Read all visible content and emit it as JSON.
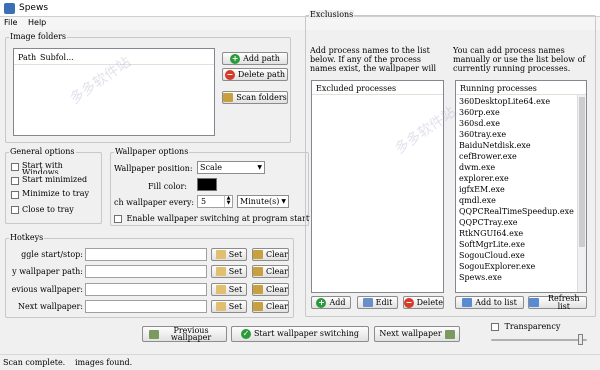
{
  "window": {
    "title": "Spews"
  },
  "menu": [
    "File",
    "Help"
  ],
  "image_folders": {
    "legend": "Image folders",
    "columns": [
      "Path",
      "Subfol..."
    ],
    "add_label": "Add path",
    "delete_label": "Delete path",
    "scan_label": "Scan folders"
  },
  "general": {
    "legend": "General options",
    "options": [
      {
        "label": "Start with Windows",
        "checked": false
      },
      {
        "label": "Start minimized",
        "checked": false
      },
      {
        "label": "Minimize to tray",
        "checked": false
      },
      {
        "label": "Close to tray",
        "checked": false
      }
    ]
  },
  "wallpaper": {
    "legend": "Wallpaper options",
    "position_label": "Wallpaper position:",
    "position_value": "Scale",
    "fill_label": "Fill color:",
    "fill_color": "#000000",
    "every_label": "ch wallpaper every:",
    "every_value": "5",
    "unit_value": "Minute(s)",
    "enable_label": "Enable wallpaper switching at program startup"
  },
  "hotkeys": {
    "legend": "Hotkeys",
    "set_label": "Set",
    "clear_label": "Clear",
    "rows": [
      {
        "label": "ggle start/stop:"
      },
      {
        "label": "y wallpaper path:"
      },
      {
        "label": "evious wallpaper:"
      },
      {
        "label": "Next wallpaper:"
      }
    ]
  },
  "exclusions": {
    "legend": "Exclusions",
    "desc_left": "Add process names to the list below.  If any of the process names exist, the wallpaper will",
    "desc_right": "You can add process names manually or use the list below of currently running processes.",
    "excluded_header": "Excluded processes",
    "running_header": "Running processes",
    "running": [
      "360DesktopLite64.exe",
      "360rp.exe",
      "360sd.exe",
      "360tray.exe",
      "BaiduNetdisk.exe",
      "cefBrower.exe",
      "dwm.exe",
      "explorer.exe",
      "igfxEM.exe",
      "qmdl.exe",
      "QQPCRealTimeSpeedup.exe",
      "QQPCTray.exe",
      "RtkNGUI64.exe",
      "SoftMgrLite.exe",
      "SogouCloud.exe",
      "SogouExplorer.exe",
      "Spews.exe"
    ],
    "add_label": "Add",
    "edit_label": "Edit",
    "delete_label": "Delete",
    "add_to_list_label": "Add to list",
    "refresh_label": "Refresh list"
  },
  "bottom": {
    "previous_label": "Previous wallpaper",
    "start_label": "Start wallpaper switching",
    "next_label": "Next wallpaper",
    "transparency_label": "Transparency"
  },
  "status": {
    "left": "Scan complete.",
    "right": "images found."
  },
  "watermark": "多多软件站"
}
